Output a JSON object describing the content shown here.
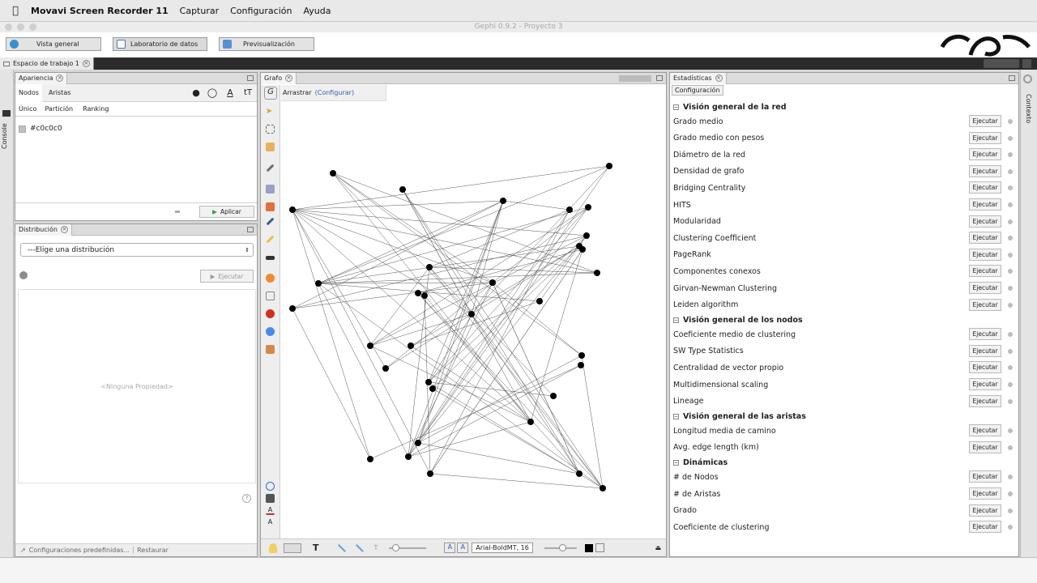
{
  "menubar": {
    "app": "Movavi Screen Recorder 11",
    "items": [
      "Capturar",
      "Configuración",
      "Ayuda"
    ]
  },
  "window": {
    "title": "Gephi 0.9.2 - Proyecto 3"
  },
  "toolbar": {
    "overview": "Vista general",
    "data_lab": "Laboratorio de datos",
    "preview": "Previsualización"
  },
  "workspace_tab": "Espacio de trabajo 1",
  "side_labels": {
    "console": "Console",
    "context": "Contexto"
  },
  "appearance": {
    "tab": "Apariencia",
    "nodes": "Nodos",
    "edges": "Aristas",
    "unique": "Único",
    "partition": "Partición",
    "ranking": "Ranking",
    "color": "#c0c0c0",
    "apply": "Aplicar"
  },
  "distribution": {
    "tab": "Distribución",
    "select": "---Elige una distribución",
    "run": "Ejecutar",
    "empty": "<Ninguna Propiedad>",
    "presets": "Configuraciones predefinidas...",
    "restore": "Restaurar"
  },
  "graph": {
    "tab": "Grafo",
    "tool": "Arrastrar",
    "configure": "(Configurar)",
    "font": "Arial-BoldMT, 16"
  },
  "stats": {
    "tab": "Estadísticas",
    "config": "Configuración",
    "run_label": "Ejecutar",
    "sections": [
      {
        "title": "Visión general de la red",
        "items": [
          "Grado medio",
          "Grado medio con pesos",
          "Diámetro de la red",
          "Densidad de grafo",
          "Bridging Centrality",
          "HITS",
          "Modularidad",
          "Clustering Coefficient",
          "PageRank",
          "Componentes conexos",
          "Girvan-Newman Clustering",
          "Leiden algorithm"
        ]
      },
      {
        "title": "Visión general de los nodos",
        "items": [
          "Coeficiente medio de clustering",
          "SW Type Statistics",
          "Centralidad de vector propio",
          "Multidimensional scaling",
          "Lineage"
        ]
      },
      {
        "title": "Visión general de las aristas",
        "items": [
          "Longitud media de camino",
          "Avg. edge length (km)"
        ]
      },
      {
        "title": "Dinámicas",
        "items": [
          "# de Nodos",
          "# de Aristas",
          "Grado",
          "Coeficiente de clustering"
        ]
      }
    ]
  },
  "colors": {
    "accent_blue": "#2e5fb8",
    "toolbar_blue": "#3a7fc4",
    "node": "#000000"
  }
}
